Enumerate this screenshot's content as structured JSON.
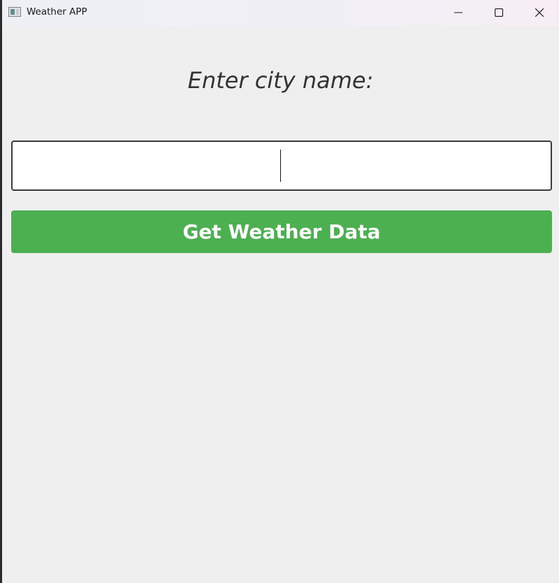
{
  "window": {
    "title": "Weather APP",
    "icon": "app-window-icon",
    "controls": {
      "minimize_icon": "minimize-icon",
      "maximize_icon": "maximize-icon",
      "close_icon": "close-icon"
    }
  },
  "main": {
    "prompt": "Enter city name:",
    "city_input": {
      "value": "",
      "placeholder": ""
    },
    "get_button_label": "Get Weather Data"
  },
  "colors": {
    "background": "#efefef",
    "button": "#4caf50",
    "button_text": "#ffffff",
    "label_text": "#333333"
  }
}
